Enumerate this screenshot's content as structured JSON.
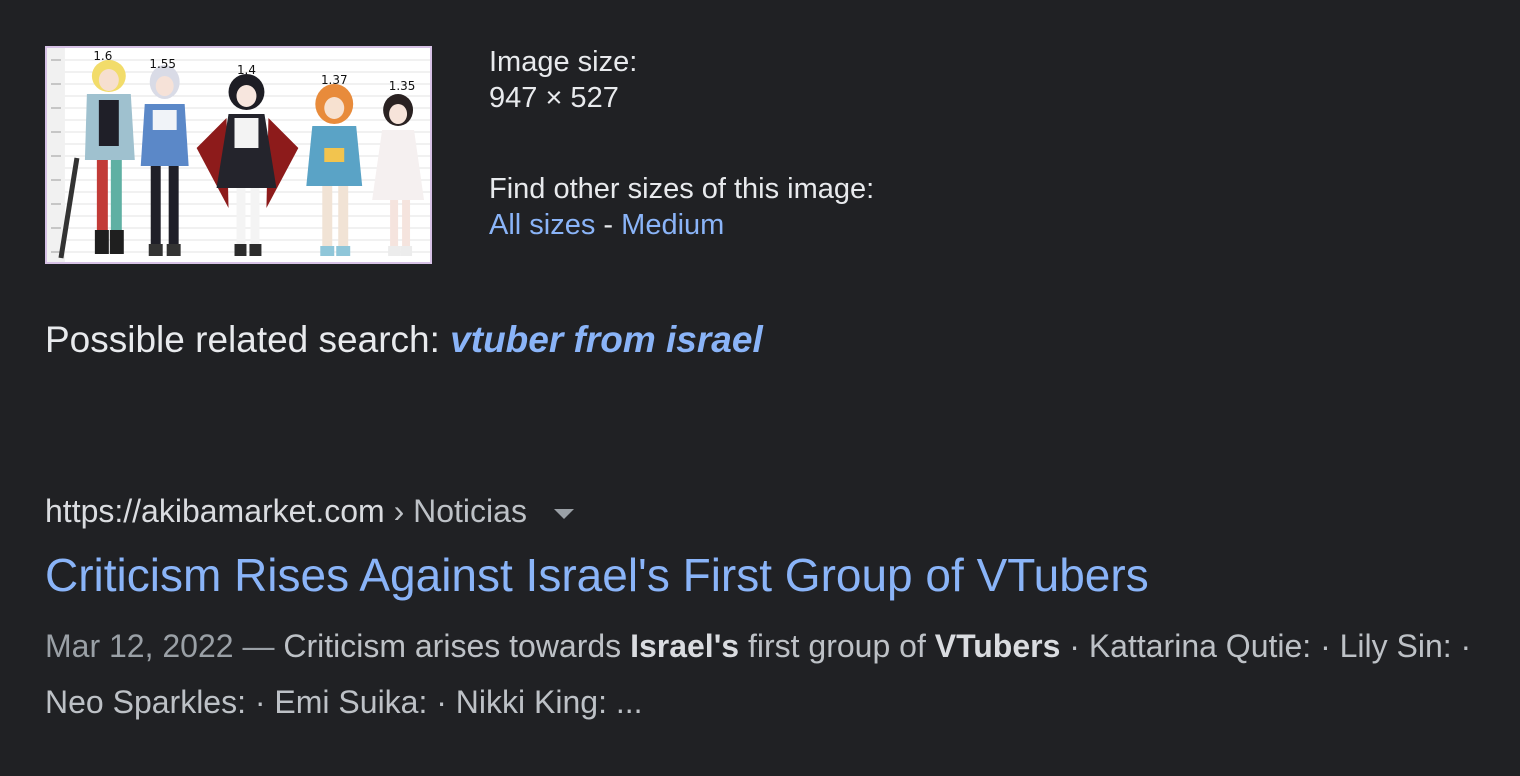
{
  "thumbnail": {
    "height_labels": [
      "1.6",
      "1.55",
      "1.4",
      "1.37",
      "1.35"
    ],
    "border_color": "#d7c2e6"
  },
  "image_info": {
    "size_label": "Image size:",
    "size_value": "947 × 527",
    "other_sizes_label": "Find other sizes of this image:",
    "all_sizes_link": "All sizes",
    "separator": "-",
    "medium_link": "Medium"
  },
  "related_search": {
    "label": "Possible related search:",
    "query": "vtuber from israel"
  },
  "result": {
    "url": "https://akibamarket.com",
    "breadcrumb": "› Noticias",
    "title": "Criticism Rises Against Israel's First Group of VTubers",
    "date": "Mar 12, 2022",
    "dash": "—",
    "snippet_1": "Criticism arises towards",
    "snippet_bold_1": "Israel's",
    "snippet_2": "first group of",
    "snippet_bold_2": "VTubers",
    "snippet_3": "· Kattarina Qutie: · Lily Sin: · Neo Sparkles: · Emi Suika: · Nikki King: ..."
  },
  "colors": {
    "background": "#202124",
    "link": "#8ab4f8",
    "text": "#bdc1c6",
    "text_bright": "#e8eaed"
  }
}
